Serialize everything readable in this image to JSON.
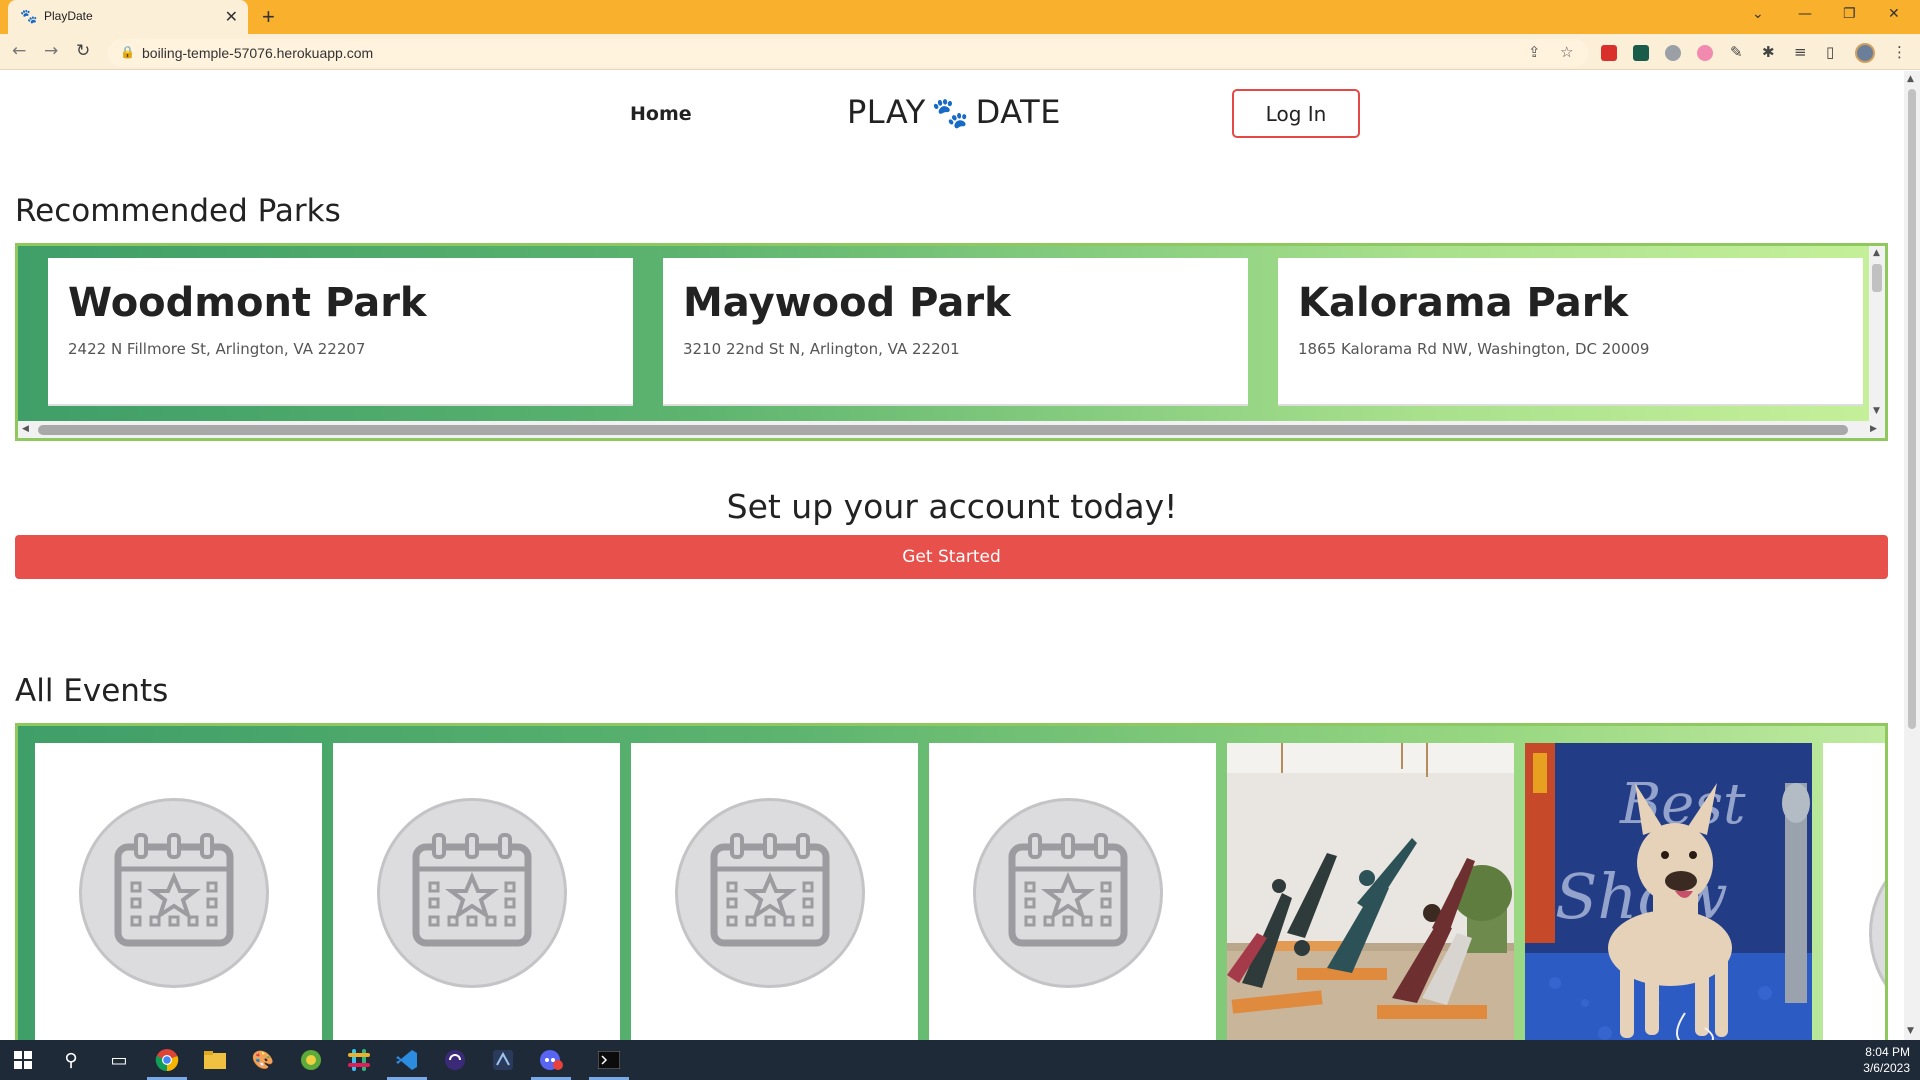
{
  "browser": {
    "tab_title": "PlayDate",
    "tab_favicon": "🐾",
    "url": "boiling-temple-57076.herokuapp.com"
  },
  "nav": {
    "home_label": "Home",
    "logo_left": "PLAY",
    "logo_right": "DATE",
    "login_label": "Log In"
  },
  "parks": {
    "title": "Recommended Parks",
    "items": [
      {
        "name": "Woodmont Park",
        "address": "2422 N Fillmore St, Arlington, VA 22207"
      },
      {
        "name": "Maywood Park",
        "address": "3210 22nd St N, Arlington, VA 22201"
      },
      {
        "name": "Kalorama Park",
        "address": "1865 Kalorama Rd NW, Washington, DC 20009"
      }
    ]
  },
  "cta": {
    "title": "Set up your account today!",
    "button_label": "Get Started"
  },
  "events": {
    "title": "All Events",
    "cards": [
      {
        "image": "calendar-placeholder-icon"
      },
      {
        "image": "calendar-placeholder-icon"
      },
      {
        "image": "calendar-placeholder-icon"
      },
      {
        "image": "calendar-placeholder-icon"
      },
      {
        "image": "yoga-class-photo"
      },
      {
        "image": "dog-show-photo"
      }
    ]
  },
  "taskbar": {
    "time": "8:04 PM",
    "date": "3/6/2023"
  },
  "colors": {
    "browser_frame": "#f9b02d",
    "accent_red": "#e8504b",
    "strip_green": "#5bb36e"
  }
}
